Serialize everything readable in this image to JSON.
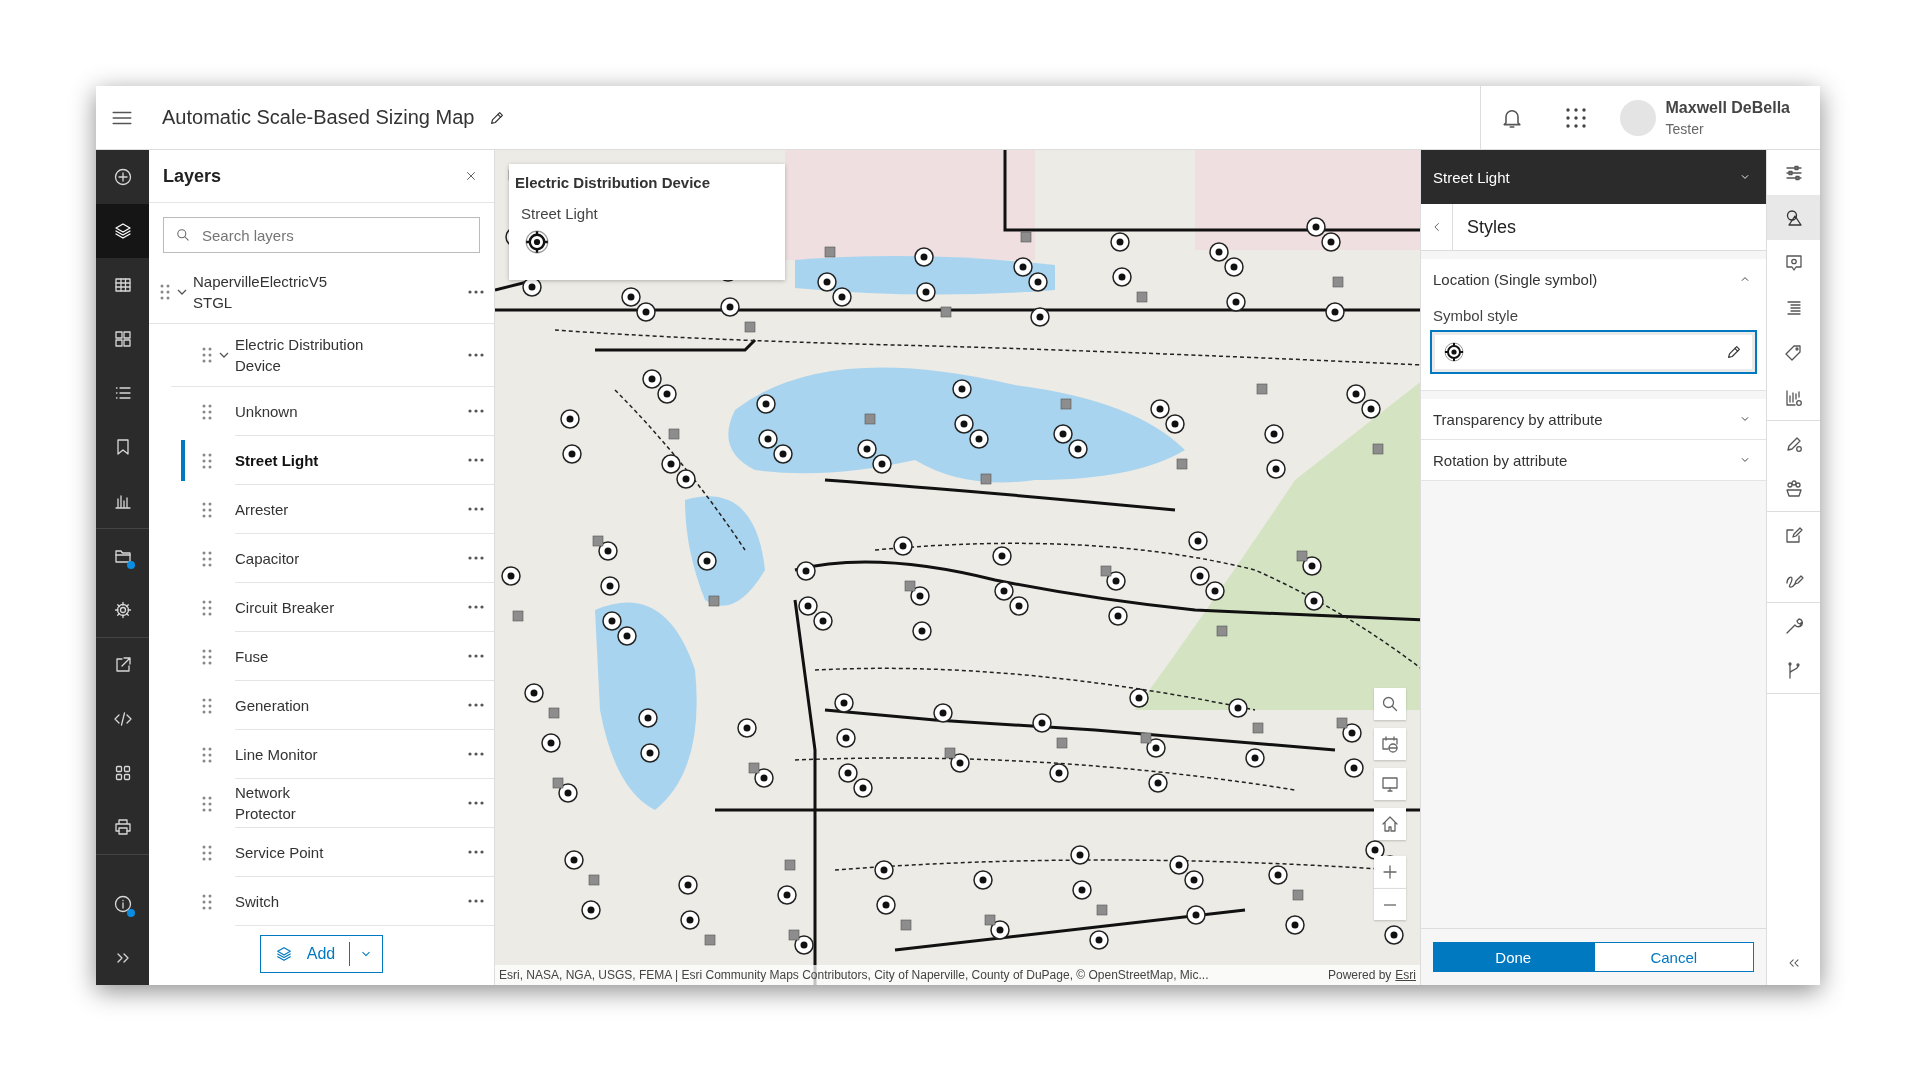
{
  "header": {
    "title": "Automatic Scale-Based Sizing Map",
    "user": {
      "name": "Maxwell DeBella",
      "role": "Tester"
    }
  },
  "left_rail": {
    "groups": [
      [
        {
          "kind": "add",
          "selected": false,
          "badge": false
        },
        {
          "kind": "layers",
          "selected": true,
          "badge": false
        },
        {
          "kind": "table",
          "selected": false,
          "badge": false
        },
        {
          "kind": "basemap",
          "selected": false,
          "badge": false
        },
        {
          "kind": "legend",
          "selected": false,
          "badge": false
        },
        {
          "kind": "bookmark",
          "selected": false,
          "badge": false
        },
        {
          "kind": "charts",
          "selected": false,
          "badge": false
        }
      ],
      [
        {
          "kind": "folder",
          "selected": false,
          "badge": true
        },
        {
          "kind": "settings",
          "selected": false,
          "badge": false
        }
      ],
      [
        {
          "kind": "share",
          "selected": false,
          "badge": false
        },
        {
          "kind": "embed",
          "selected": false,
          "badge": false
        },
        {
          "kind": "apps",
          "selected": false,
          "badge": false
        },
        {
          "kind": "print",
          "selected": false,
          "badge": false
        }
      ]
    ],
    "bottom": [
      {
        "kind": "info",
        "selected": false,
        "badge": true
      },
      {
        "kind": "expand",
        "selected": false,
        "badge": false
      }
    ]
  },
  "layers_panel": {
    "title": "Layers",
    "search": {
      "placeholder": "Search layers"
    },
    "tree": [
      {
        "label": "NapervilleElectricV5 STGL",
        "expanded": true,
        "children": [
          {
            "label": "Electric Distribution Device",
            "expanded": true,
            "children": [
              {
                "label": "Unknown",
                "selected": false
              },
              {
                "label": "Street Light",
                "selected": true
              },
              {
                "label": "Arrester",
                "selected": false
              },
              {
                "label": "Capacitor",
                "selected": false
              },
              {
                "label": "Circuit Breaker",
                "selected": false
              },
              {
                "label": "Fuse",
                "selected": false
              },
              {
                "label": "Generation",
                "selected": false
              },
              {
                "label": "Line Monitor",
                "selected": false
              },
              {
                "label": "Network Protector",
                "selected": false
              },
              {
                "label": "Service Point",
                "selected": false
              },
              {
                "label": "Switch",
                "selected": false
              }
            ]
          }
        ]
      }
    ],
    "add_button": {
      "label": "Add"
    }
  },
  "map": {
    "popup": {
      "title": "Electric Distribution Device",
      "subtitle": "Street Light"
    },
    "controls": [
      {
        "kind": "search"
      },
      {
        "kind": "basemap-gallery"
      },
      {
        "kind": "screen"
      },
      {
        "kind": "home"
      },
      {
        "kind": "zoom-in"
      },
      {
        "kind": "zoom-out"
      }
    ],
    "attribution": "Esri, NASA, NGA, USGS, FEMA | Esri Community Maps Contributors, City of Naperville, County of DuPage, © OpenStreetMap, Mic...",
    "powered_by": "Powered by",
    "powered_link": "Esri"
  },
  "style_panel": {
    "layer": "Street Light",
    "title": "Styles",
    "sections": [
      {
        "label": "Location (Single symbol)",
        "expanded": true,
        "field_label": "Symbol style"
      },
      {
        "label": "Transparency by attribute",
        "expanded": false
      },
      {
        "label": "Rotation by attribute",
        "expanded": false
      }
    ],
    "buttons": [
      {
        "label": "Done",
        "kind": "primary"
      },
      {
        "label": "Cancel",
        "kind": "secondary"
      }
    ]
  },
  "right_rail": {
    "groups": [
      [
        {
          "kind": "properties",
          "selected": false
        },
        {
          "kind": "styles",
          "selected": true
        },
        {
          "kind": "popups",
          "selected": false
        },
        {
          "kind": "fields",
          "selected": false
        },
        {
          "kind": "labels",
          "selected": false
        },
        {
          "kind": "chart-settings",
          "selected": false
        }
      ],
      [
        {
          "kind": "edit-settings",
          "selected": false
        },
        {
          "kind": "groups",
          "selected": false
        }
      ],
      [
        {
          "kind": "forms",
          "selected": false
        },
        {
          "kind": "sketch",
          "selected": false
        }
      ],
      [
        {
          "kind": "tools",
          "selected": false
        },
        {
          "kind": "branch",
          "selected": false
        }
      ]
    ]
  }
}
